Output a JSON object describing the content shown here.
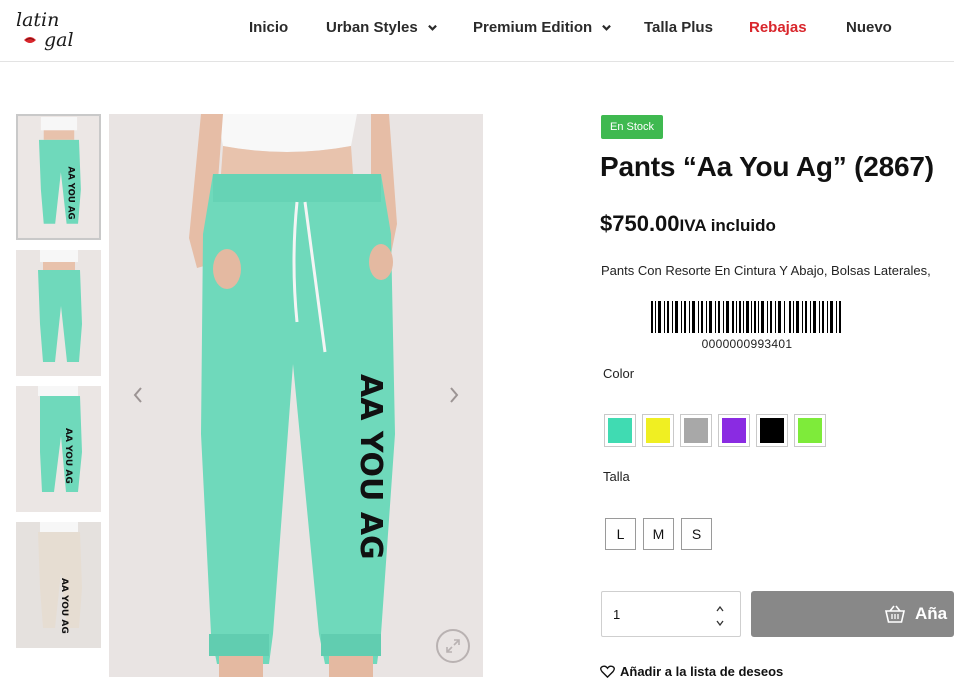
{
  "brand": {
    "logo_text_line1": "latin",
    "logo_text_line2": "gal"
  },
  "nav": {
    "items": [
      {
        "label": "Inicio",
        "dropdown": false
      },
      {
        "label": "Urban Styles",
        "dropdown": true
      },
      {
        "label": "Premium Edition",
        "dropdown": true
      },
      {
        "label": "Talla Plus",
        "dropdown": false
      },
      {
        "label": "Rebajas",
        "dropdown": false,
        "highlight_color": "#d9262c"
      },
      {
        "label": "Nuevo",
        "dropdown": false
      }
    ]
  },
  "gallery": {
    "thumbnails": [
      {
        "color": "#6fd9bb",
        "print": ""
      },
      {
        "color": "#6fd9bb",
        "print": ""
      },
      {
        "color": "#6fd9bb",
        "print": "AA YOU AG"
      },
      {
        "color": "#e6ddd2",
        "print": "AA YOU AG"
      }
    ],
    "main_print_text": "AA YOU AG",
    "prev_icon": "chevron-left-icon",
    "next_icon": "chevron-right-icon",
    "zoom_icon": "expand-icon"
  },
  "product": {
    "stock_badge": "En Stock",
    "title": "Pants “Aa You Ag” (2867)",
    "price": "$750.00",
    "price_suffix": "IVA incluido",
    "description": "Pants Con Resorte En Cintura Y Abajo, Bolsas Laterales,",
    "barcode_number": "0000000993401",
    "color_label": "Color",
    "colors": [
      "#40dbb2",
      "#f0ef22",
      "#a8a8a8",
      "#8a2be2",
      "#000000",
      "#7eeb3a"
    ],
    "size_label": "Talla",
    "sizes": [
      "L",
      "M",
      "S"
    ],
    "quantity": "1",
    "add_to_cart_label": "Aña",
    "wishlist_label": "Añadir a la lista de deseos"
  },
  "theme": {
    "badge_color": "#3fb950",
    "button_color": "#888888",
    "accent_red": "#d9262c"
  }
}
